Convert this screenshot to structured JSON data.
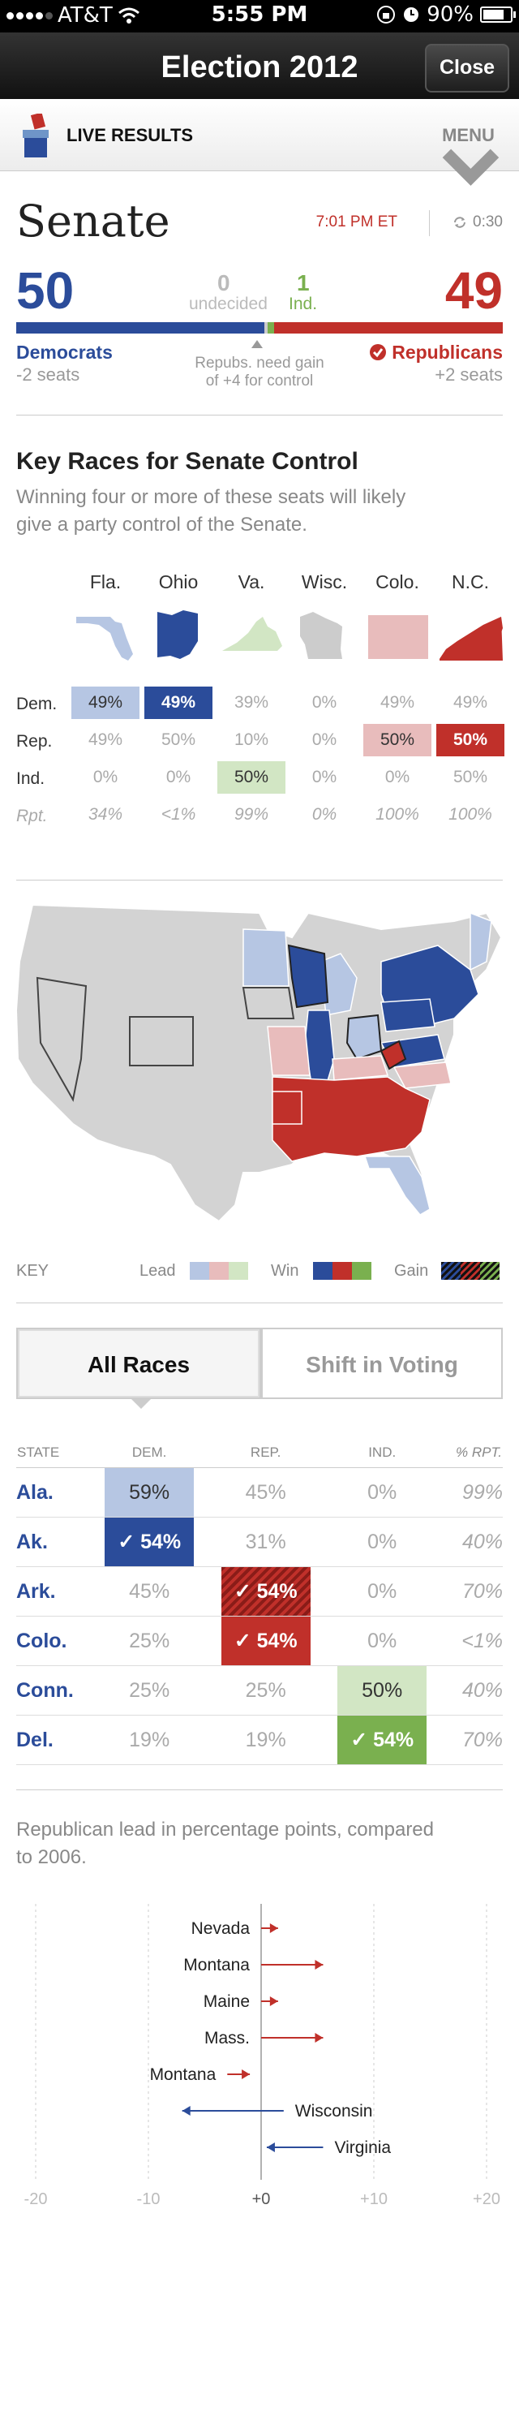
{
  "status_bar": {
    "carrier": "AT&T",
    "time": "5:55 PM",
    "battery": "90%",
    "battery_level": 0.9
  },
  "nav": {
    "title": "Election 2012",
    "close_label": "Close"
  },
  "subnav": {
    "live_label": "LIVE RESULTS",
    "menu_label": "MENU"
  },
  "summary": {
    "title": "Senate",
    "timestamp": "7:01 PM ET",
    "countdown": "0:30",
    "dem_count": "50",
    "rep_count": "49",
    "undecided_count": "0",
    "undecided_label": "undecided",
    "ind_count": "1",
    "ind_label": "Ind.",
    "dem_label": "Democrats",
    "dem_change": "-2 seats",
    "rep_label": "Republicans",
    "rep_change": "+2 seats",
    "note_line1": "Repubs. need gain",
    "note_line2": "of +4 for control",
    "colors": {
      "dem": "#2b4c9a",
      "rep": "#c0302a",
      "ind": "#7ab04f",
      "undecided": "#cccccc"
    }
  },
  "key_races": {
    "title": "Key Races for Senate Control",
    "description_line1": "Winning four or more of these seats will likely",
    "description_line2": "give a party control of the Senate.",
    "row_labels": [
      "Dem.",
      "Rep.",
      "Ind.",
      "Rpt."
    ],
    "states": [
      {
        "name": "Fla.",
        "dem": "49%",
        "rep": "49%",
        "ind": "0%",
        "rpt": "34%"
      },
      {
        "name": "Ohio",
        "dem": "49%",
        "rep": "50%",
        "ind": "0%",
        "rpt": "<1%"
      },
      {
        "name": "Va.",
        "dem": "39%",
        "rep": "10%",
        "ind": "50%",
        "rpt": "99%"
      },
      {
        "name": "Wisc.",
        "dem": "0%",
        "rep": "0%",
        "ind": "0%",
        "rpt": "0%"
      },
      {
        "name": "Colo.",
        "dem": "49%",
        "rep": "50%",
        "ind": "0%",
        "rpt": "100%"
      },
      {
        "name": "N.C.",
        "dem": "49%",
        "rep": "50%",
        "ind": "50%",
        "rpt": "100%"
      }
    ]
  },
  "map_key": {
    "label": "KEY",
    "lead": "Lead",
    "win": "Win",
    "gain": "Gain"
  },
  "tabs": {
    "all_races": "All Races",
    "shift": "Shift in Voting"
  },
  "races_table": {
    "headers": {
      "state": "STATE",
      "dem": "DEM.",
      "rep": "REP.",
      "ind": "IND.",
      "rpt": "% RPT."
    },
    "rows": [
      {
        "state": "Ala.",
        "dem": "59%",
        "rep": "45%",
        "ind": "0%",
        "rpt": "99%"
      },
      {
        "state": "Ak.",
        "dem": "✓ 54%",
        "rep": "31%",
        "ind": "0%",
        "rpt": "40%"
      },
      {
        "state": "Ark.",
        "dem": "45%",
        "rep": "✓ 54%",
        "ind": "0%",
        "rpt": "70%"
      },
      {
        "state": "Colo.",
        "dem": "25%",
        "rep": "✓ 54%",
        "ind": "0%",
        "rpt": "<1%"
      },
      {
        "state": "Conn.",
        "dem": "25%",
        "rep": "25%",
        "ind": "50%",
        "rpt": "40%"
      },
      {
        "state": "Del.",
        "dem": "19%",
        "rep": "19%",
        "ind": "✓ 54%",
        "rpt": "70%"
      }
    ]
  },
  "shift": {
    "description_line1": "Republican lead in percentage points, compared",
    "description_line2": "to 2006.",
    "chart_data": {
      "type": "bar",
      "x_ticks": [
        "-20",
        "-10",
        "+0",
        "+10",
        "+20"
      ],
      "xlim": [
        -20,
        20
      ],
      "arrows": [
        {
          "label": "Nevada",
          "from": 0,
          "to": 1.5,
          "party": "rep"
        },
        {
          "label": "Montana",
          "from": 0,
          "to": 5.5,
          "party": "rep"
        },
        {
          "label": "Maine",
          "from": 0,
          "to": 1.5,
          "party": "rep"
        },
        {
          "label": "Mass.",
          "from": 0,
          "to": 5.5,
          "party": "rep"
        },
        {
          "label": "Montana",
          "from": -3,
          "to": -1,
          "party": "rep"
        },
        {
          "label": "Wisconsin",
          "from": 2,
          "to": -7,
          "party": "dem"
        },
        {
          "label": "Virginia",
          "from": 5.5,
          "to": 0.5,
          "party": "dem"
        }
      ]
    }
  }
}
